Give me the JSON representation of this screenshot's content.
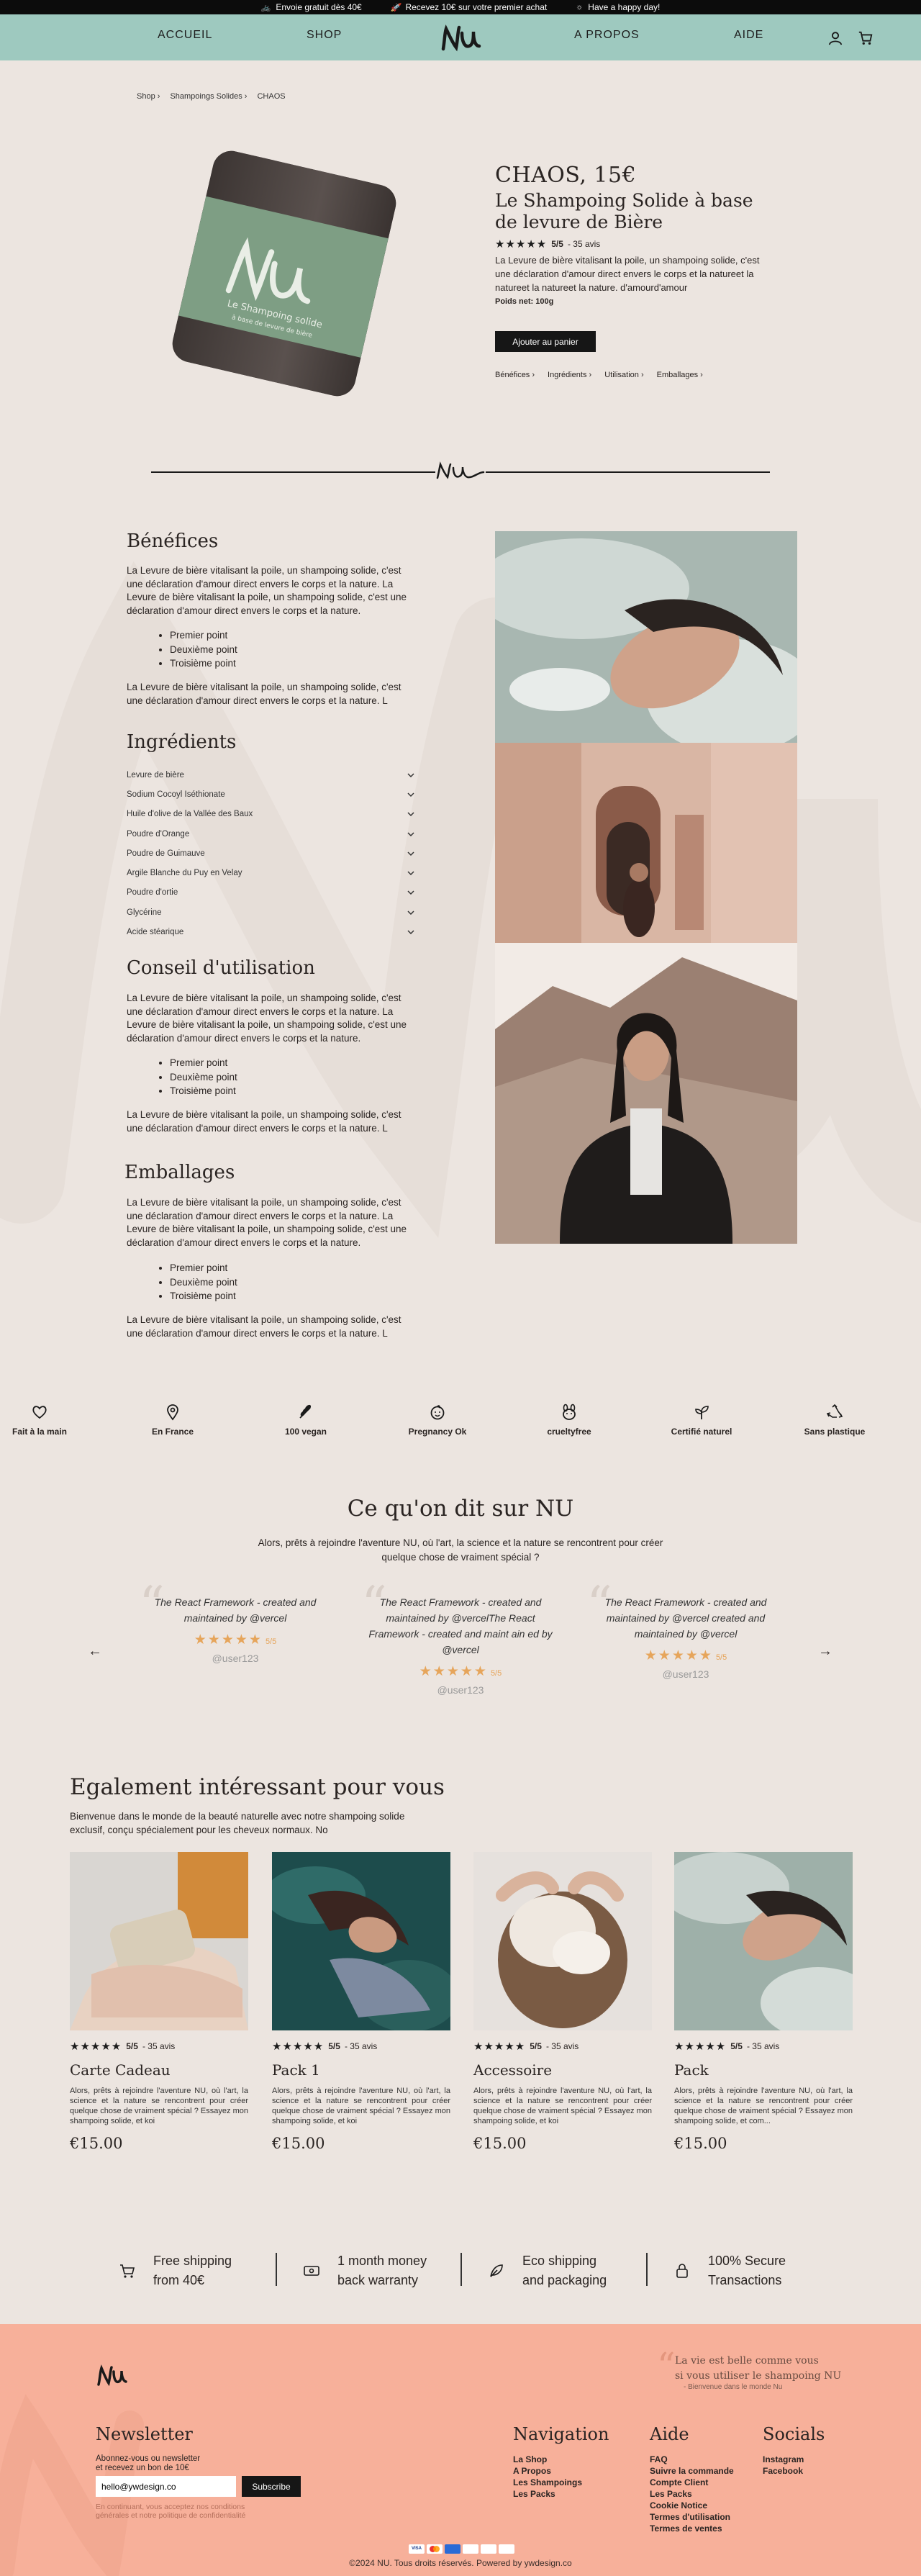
{
  "topbar": {
    "items": [
      "Envoie gratuit dès 40€",
      "Recevez 10€ sur votre premier achat",
      "Have a happy day!"
    ]
  },
  "nav": {
    "links": [
      "ACCUEIL",
      "SHOP",
      "A PROPOS",
      "AIDE"
    ],
    "logo": "NU"
  },
  "breadcrumb": [
    "Shop",
    "Shampoings Solides",
    "CHAOS"
  ],
  "product": {
    "name_price": "CHAOS, 15€",
    "subtitle": "Le Shampoing Solide à base de levure de Bière",
    "stars": "★★★★★",
    "rating": "5/5",
    "reviews": "- 35 avis",
    "description": "La Levure de bière vitalisant la poile, un shampoing solide, c'est une déclaration d'amour direct envers le corps et la natureet la natureet la natureet la nature. d'amourd'amour",
    "net_weight": "Poids net: 100g",
    "add_to_cart": "Ajouter au panier",
    "anchors": [
      "Bénéfices",
      "Ingrédients",
      "Utilisation",
      "Emballages"
    ],
    "soap_label": "Le Shampoing solide",
    "soap_sub": "à base de levure de bière"
  },
  "sections": {
    "benefits": {
      "title": "Bénéfices",
      "p1": "La Levure de bière vitalisant la poile, un shampoing solide, c'est une déclaration d'amour direct envers le corps et la nature. La Levure de bière vitalisant la poile, un shampoing solide, c'est une déclaration d'amour direct envers le corps et la nature.",
      "bullets": [
        "Premier point",
        "Deuxième point",
        "Troisième point"
      ],
      "p2": "La Levure de bière vitalisant la poile, un shampoing solide, c'est une déclaration d'amour direct envers le corps et la nature. L"
    },
    "ingredients": {
      "title": "Ingrédients",
      "items": [
        "Levure de bière",
        "Sodium Cocoyl Iséthionate",
        "Huile d'olive de la Vallée des Baux",
        "Poudre d'Orange",
        "Poudre de Guimauve",
        "Argile Blanche du Puy en Velay",
        "Poudre d'ortie",
        "Glycérine",
        "Acide stéarique"
      ]
    },
    "usage": {
      "title": "Conseil d'utilisation",
      "p1": "La Levure de bière vitalisant la poile, un shampoing solide, c'est une déclaration d'amour direct envers le corps et la nature. La Levure de bière vitalisant la poile, un shampoing solide, c'est une déclaration d'amour direct envers le corps et la nature.",
      "bullets": [
        "Premier point",
        "Deuxième point",
        "Troisième point"
      ],
      "p2": "La Levure de bière vitalisant la poile, un shampoing solide, c'est une déclaration d'amour direct envers le corps et la nature. L"
    },
    "packaging": {
      "title": "Emballages",
      "p1": "La Levure de bière vitalisant la poile, un shampoing solide, c'est une déclaration d'amour direct envers le corps et la nature. La Levure de bière vitalisant la poile, un shampoing solide, c'est une déclaration d'amour direct envers le corps et la nature.",
      "bullets": [
        "Premier point",
        "Deuxième point",
        "Troisième point"
      ],
      "p2": "La Levure de bière vitalisant la poile, un shampoing solide, c'est une déclaration d'amour direct envers le corps et la nature. L"
    }
  },
  "features": [
    "Fait à la main",
    "En France",
    "100 vegan",
    "Pregnancy Ok",
    "crueltyfree",
    "Certifié naturel",
    "Sans plastique"
  ],
  "testimonials": {
    "title": "Ce qu'on dit sur NU",
    "subtitle": "Alors, prêts à rejoindre l'aventure NU, où l'art, la science et la nature se rencontrent pour créer quelque chose de vraiment spécial ?",
    "items": [
      {
        "text": "The React Framework - created and maintained by @vercel",
        "rating": "5/5",
        "user": "@user123"
      },
      {
        "text": "The React Framework - created and maintained by @vercelThe React Framework - created and maint ain ed by @vercel",
        "rating": "5/5",
        "user": "@user123"
      },
      {
        "text": "The React Framework - created and maintained by @vercel created and maintained by @vercel",
        "rating": "5/5",
        "user": "@user123"
      }
    ]
  },
  "related": {
    "title": "Egalement intéressant pour vous",
    "subtitle": "Bienvenue dans le monde de la beauté naturelle avec notre shampoing solide exclusif, conçu spécialement pour les cheveux normaux. No",
    "cards": [
      {
        "name": "Carte Cadeau",
        "rating": "5/5",
        "reviews": "- 35 avis",
        "desc": "Alors, prêts à rejoindre l'aventure NU, où l'art, la science et la nature se rencontrent pour créer quelque chose de vraiment spécial ? Essayez mon shampoing solide, et koi",
        "price": "€15.00"
      },
      {
        "name": "Pack 1",
        "rating": "5/5",
        "reviews": "- 35 avis",
        "desc": "Alors, prêts à rejoindre l'aventure NU, où l'art, la science et la nature se rencontrent pour créer quelque chose de vraiment spécial ? Essayez mon shampoing solide, et koi",
        "price": "€15.00"
      },
      {
        "name": "Accessoire",
        "rating": "5/5",
        "reviews": "- 35 avis",
        "desc": "Alors, prêts à rejoindre l'aventure NU, où l'art, la science et la nature se rencontrent pour créer quelque chose de vraiment spécial ? Essayez mon shampoing solide, et koi",
        "price": "€15.00"
      },
      {
        "name": "Pack",
        "rating": "5/5",
        "reviews": "- 35 avis",
        "desc": "Alors, prêts à rejoindre l'aventure NU, où l'art, la science et la nature se rencontrent pour créer quelque chose de vraiment spécial ? Essayez mon shampoing solide, et com...",
        "price": "€15.00"
      }
    ]
  },
  "benefits_bar": [
    {
      "l1": "Free shipping",
      "l2": "from 40€"
    },
    {
      "l1": "1 month money",
      "l2": "back warranty"
    },
    {
      "l1": "Eco shipping",
      "l2": "and packaging"
    },
    {
      "l1": "100% Secure",
      "l2": "Transactions"
    }
  ],
  "footer": {
    "quote_l1": "La vie est belle comme vous",
    "quote_l2": "si vous utiliser le shampoing NU",
    "quote_by": "- Bienvenue dans le monde Nu",
    "newsletter_title": "Newsletter",
    "newsletter_text_l1": "Abonnez-vous ou newsletter",
    "newsletter_text_l2": "et recevez un bon de 10€",
    "email_value": "hello@ywdesign.co",
    "subscribe": "Subscribe",
    "consent_l1": "En continuant, vous acceptez nos conditions",
    "consent_l2": "générales et notre politique de confidentialité",
    "cols": [
      {
        "title": "Navigation",
        "links": [
          "La Shop",
          "A Propos",
          "Les Shampoings",
          "Les Packs"
        ]
      },
      {
        "title": "Aide",
        "links": [
          "FAQ",
          "Suivre la commande",
          "Compte Client",
          "Les Packs",
          "Cookie Notice",
          "Termes d'utilisation",
          "Termes de ventes"
        ]
      },
      {
        "title": "Socials",
        "links": [
          "Instagram",
          "Facebook"
        ]
      }
    ],
    "copyright": "©2024 NU. Tous droits réservés. Powered by ywdesign.co"
  },
  "colors": {
    "nav_bg": "#9ec9bf",
    "page_bg": "#ece5e0",
    "footer_bg": "#f7b09a",
    "accent_star": "#e6a55b"
  }
}
